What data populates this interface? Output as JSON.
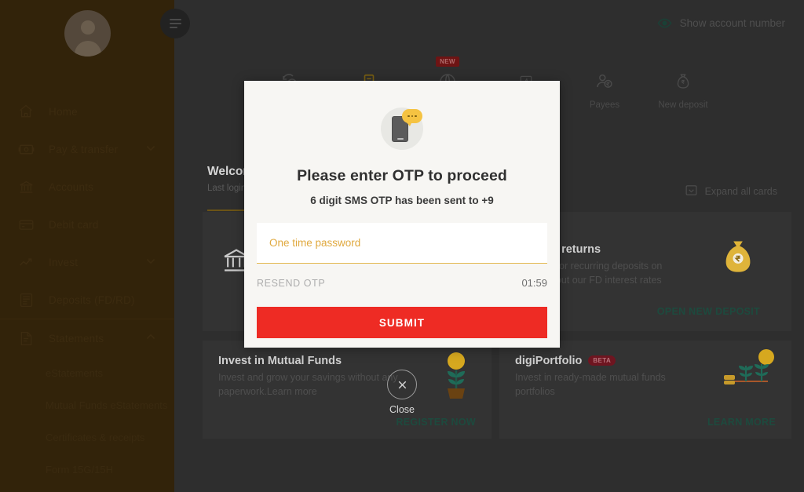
{
  "sidebar": {
    "avatar_name": "user-avatar",
    "items": [
      {
        "label": "Home",
        "icon": "home-icon",
        "expandable": false
      },
      {
        "label": "Pay & transfer",
        "icon": "pay-transfer-icon",
        "expandable": true,
        "expanded": false
      },
      {
        "label": "Accounts",
        "icon": "bank-icon",
        "expandable": false
      },
      {
        "label": "Debit card",
        "icon": "card-icon",
        "expandable": false
      },
      {
        "label": "Invest",
        "icon": "trend-up-icon",
        "expandable": true,
        "expanded": false
      },
      {
        "label": "Deposits (FD/RD)",
        "icon": "deposits-icon",
        "expandable": false
      },
      {
        "label": "Statements",
        "icon": "statements-icon",
        "expandable": true,
        "expanded": true
      }
    ],
    "sub_items": [
      {
        "label": "eStatements"
      },
      {
        "label": "Mutual Funds eStatements"
      },
      {
        "label": "Certificates & receipts"
      },
      {
        "label": "Form 15G/15H"
      }
    ]
  },
  "topbar": {
    "menu_icon": "hamburger-icon",
    "show_account_label": "Show account number",
    "eye_icon": "eye-icon",
    "eye_color": "#1a4036"
  },
  "quick_actions": [
    {
      "label": "",
      "icon": "repeat-payment-icon",
      "badge": ""
    },
    {
      "label": "",
      "icon": "bill-icon",
      "badge": ""
    },
    {
      "label": "",
      "icon": "globe-icon",
      "badge": "NEW"
    },
    {
      "label": "",
      "icon": "account-icon",
      "badge": ""
    },
    {
      "label": "Payees",
      "icon": "payee-icon",
      "badge": ""
    },
    {
      "label": "New deposit",
      "icon": "money-bag-icon",
      "badge": ""
    }
  ],
  "main": {
    "welcome_title": "Welcome",
    "welcome_sub": "Last login",
    "expand_all_label": "Expand all cards",
    "expand_all_icon": "expand-cards-icon",
    "cards": [
      {
        "title": "ctive returns",
        "desc": "Fixed or recurring deposits on\nheck out our FD interest rates",
        "cta": "OPEN NEW DEPOSIT",
        "icon": "money-bag-icon"
      },
      {
        "title": "Invest in Mutual Funds",
        "desc": "Invest and grow your savings without any\npaperwork.Learn more",
        "cta": "REGISTER NOW",
        "icon": "plant-pot-icon"
      },
      {
        "title": "digiPortfolio",
        "badge": "BETA",
        "desc": "Invest in ready-made mutual funds\nportfolios",
        "cta": "LEARN MORE",
        "icon": "plants-growth-icon"
      }
    ]
  },
  "close_overlay": {
    "label": "Close",
    "icon": "close-circle-icon"
  },
  "modal": {
    "illustration_icon": "phone-sms-icon",
    "title": "Please enter OTP to proceed",
    "subtitle": "6 digit SMS OTP has been sent to +9",
    "otp_input": {
      "placeholder": "One time password",
      "value": ""
    },
    "resend_label": "RESEND OTP",
    "timer": "01:59",
    "submit_label": "SUBMIT",
    "accent_color": "#ee2b24",
    "field_accent": "#e0a93f"
  }
}
